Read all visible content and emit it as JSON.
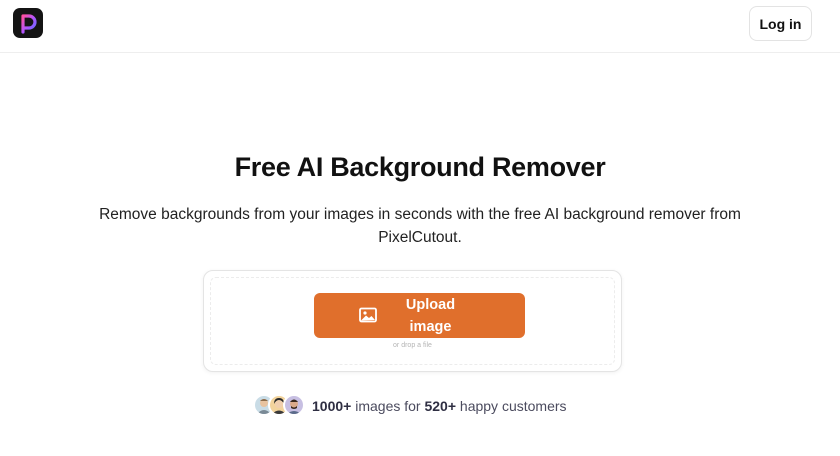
{
  "header": {
    "logo_icon": "pixelcutout-logo-icon",
    "login_label": "Log in"
  },
  "hero": {
    "title": "Free AI Background Remover",
    "subtitle": "Remove backgrounds from your images in seconds with the free AI background remover from PixelCutout."
  },
  "upload": {
    "button_label": "Upload image",
    "button_icon": "image-icon",
    "drop_hint": "or drop a file",
    "accent_color": "#e06f2c"
  },
  "social_proof": {
    "images_count": "1000+",
    "images_text": " images for ",
    "customers_count": "520+",
    "customers_text": " happy customers"
  }
}
